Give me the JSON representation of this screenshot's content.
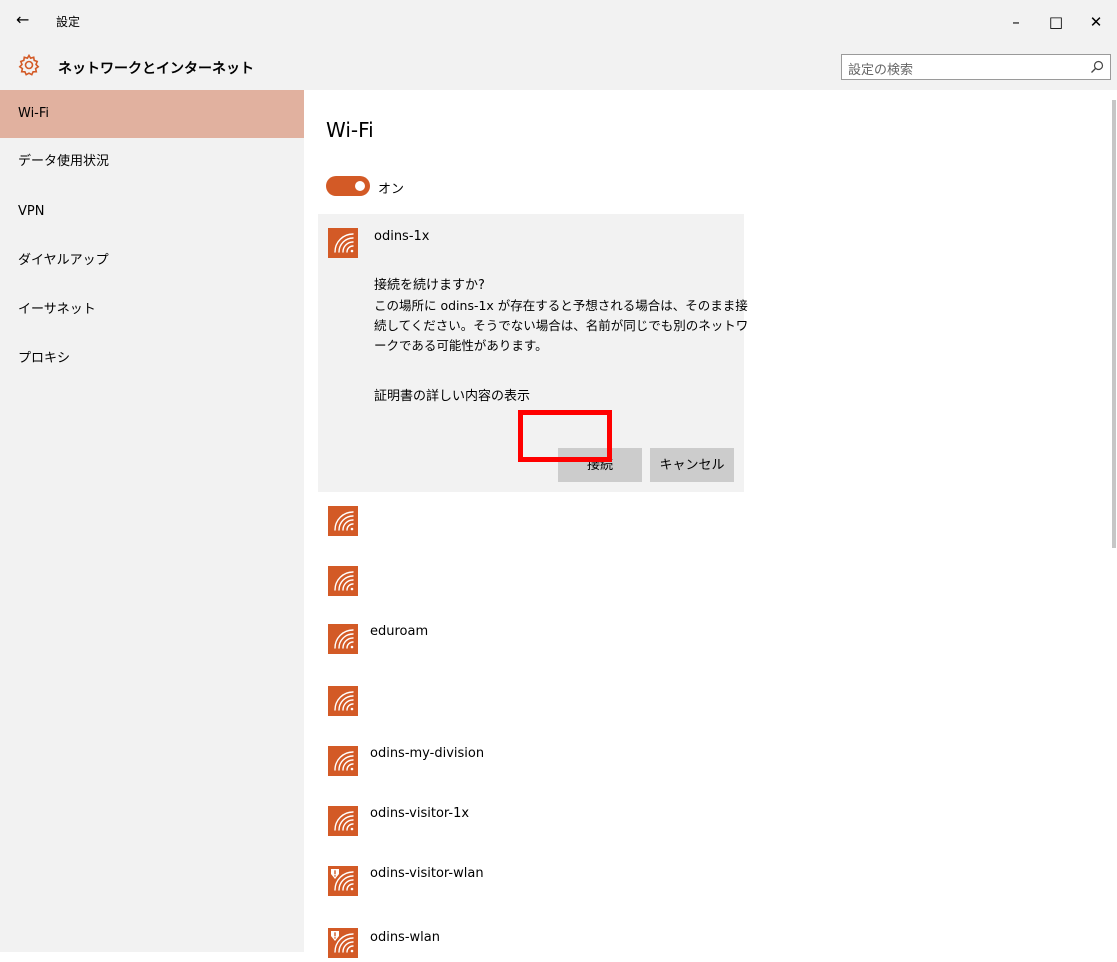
{
  "window": {
    "back_glyph": "←",
    "title": "設定",
    "minimize_glyph": "–",
    "maximize_glyph": "□",
    "close_glyph": "✕"
  },
  "header": {
    "title": "ネットワークとインターネット",
    "icon": "gear-icon",
    "search_placeholder": "設定の検索",
    "search_icon": "search-icon"
  },
  "sidebar": {
    "items": [
      {
        "label": "Wi-Fi",
        "active": true
      },
      {
        "label": "データ使用状況",
        "active": false
      },
      {
        "label": "VPN",
        "active": false
      },
      {
        "label": "ダイヤルアップ",
        "active": false
      },
      {
        "label": "イーサネット",
        "active": false
      },
      {
        "label": "プロキシ",
        "active": false
      }
    ]
  },
  "main": {
    "title": "Wi-Fi",
    "toggle_label": "オン",
    "expanded_network": {
      "name": "odins-1x",
      "question": "接続を続けますか?",
      "description": "この場所に odins-1x が存在すると予想される場合は、そのまま接続してください。そうでない場合は、名前が同じでも別のネットワークである可能性があります。",
      "cert_link": "証明書の詳しい内容の表示",
      "connect_label": "接続",
      "cancel_label": "キャンセル"
    },
    "networks": [
      {
        "name": "",
        "secured_warning": false
      },
      {
        "name": "",
        "secured_warning": false
      },
      {
        "name": "eduroam",
        "secured_warning": false
      },
      {
        "name": "",
        "secured_warning": false
      },
      {
        "name": "odins-my-division",
        "secured_warning": false
      },
      {
        "name": "odins-visitor-1x",
        "secured_warning": false
      },
      {
        "name": "odins-visitor-wlan",
        "secured_warning": true
      },
      {
        "name": "odins-wlan",
        "secured_warning": true
      }
    ]
  },
  "colors": {
    "accent": "#d35a26",
    "sidebar_active": "#e1b19f",
    "panel_bg": "#f2f2f2",
    "highlight": "#ff0000"
  }
}
